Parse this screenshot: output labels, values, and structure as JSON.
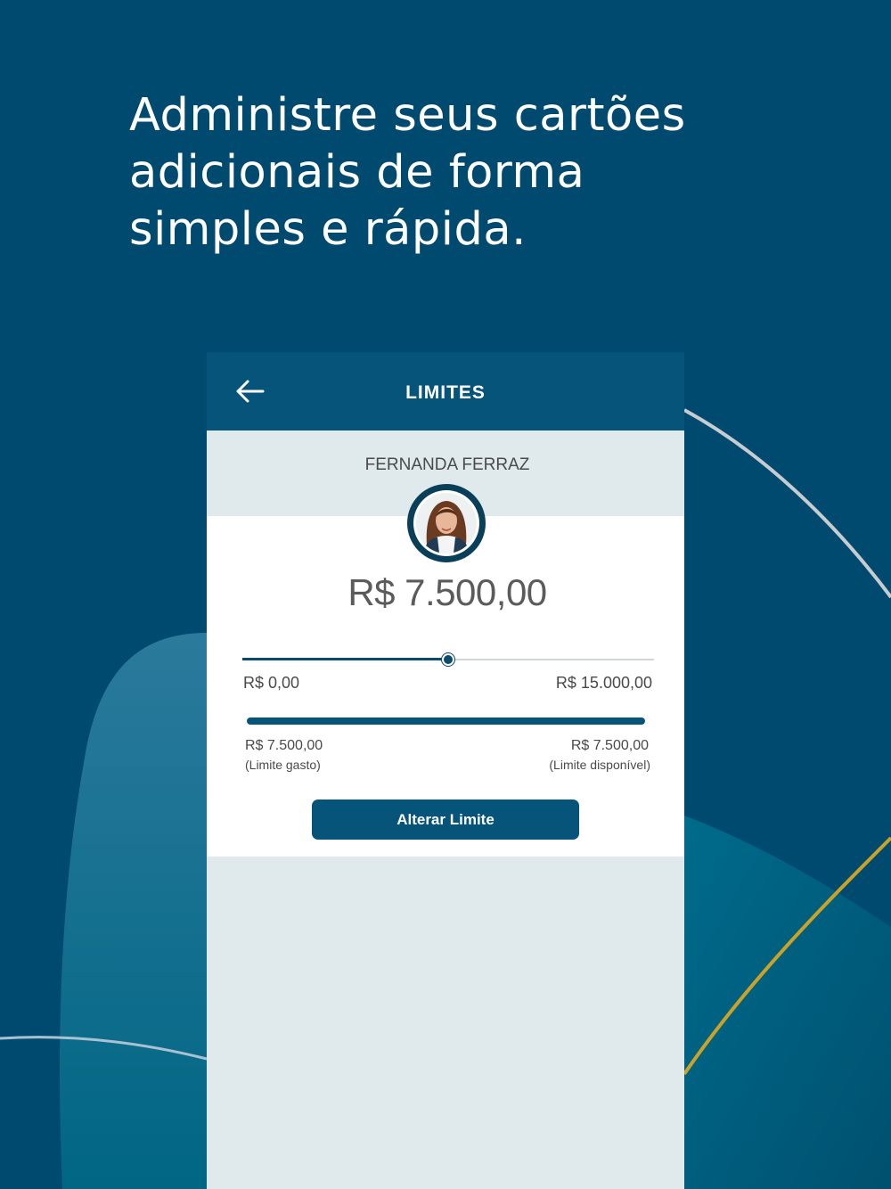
{
  "headline": {
    "line1": "Administre seus cartões",
    "line2": "adicionais de forma",
    "line3": "simples e rápida."
  },
  "appbar": {
    "back_icon": "arrow-left-icon",
    "title": "LIMITES"
  },
  "user": {
    "name": "FERNANDA FERRAZ",
    "avatar": "avatar-photo"
  },
  "limit": {
    "amount": "R$ 7.500,00",
    "slider_fraction": 0.5,
    "min_label": "R$ 0,00",
    "max_label": "R$ 15.000,00"
  },
  "usage": {
    "spent_value": "R$ 7.500,00",
    "spent_label": "(Limite gasto)",
    "available_value": "R$ 7.500,00",
    "available_label": "(Limite disponível)"
  },
  "actions": {
    "alter_label": "Alterar Limite"
  },
  "colors": {
    "background": "#004a70",
    "appbar": "#06547a",
    "panel": "#e0eaed",
    "accent_gold": "#c9a227"
  }
}
